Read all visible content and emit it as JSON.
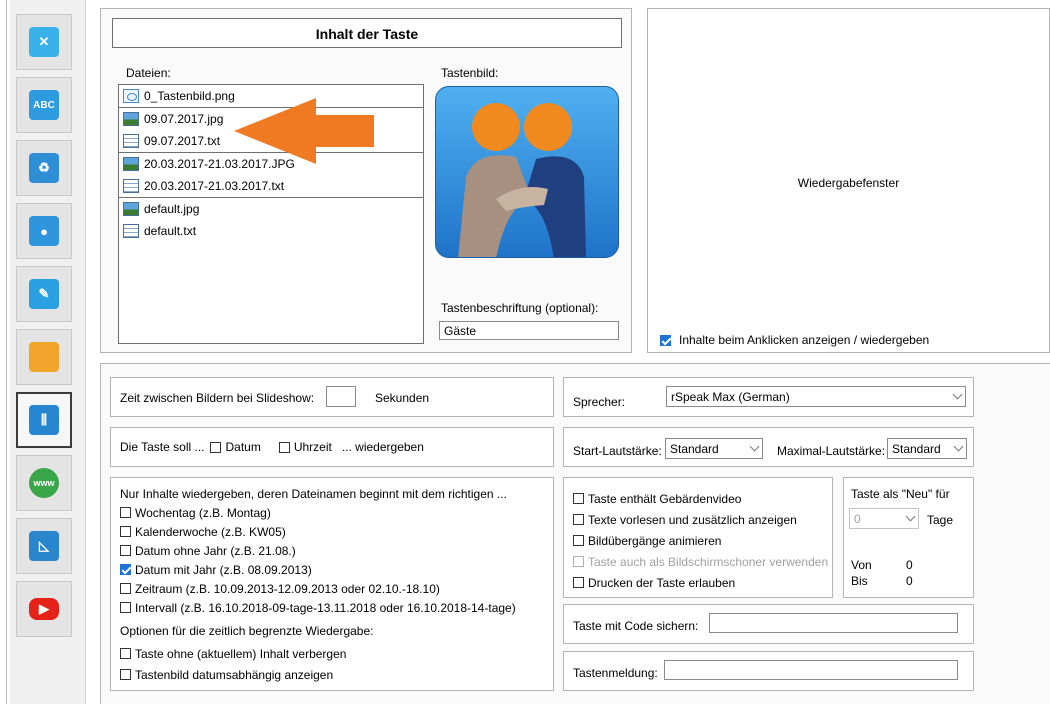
{
  "colors": {
    "accent": "#1e74d2",
    "arrow": "#f07a22"
  },
  "sidebar": {
    "tools": [
      {
        "icon": "tools-icon",
        "label": "Werkzeuge"
      },
      {
        "icon": "abc-eraser-icon",
        "label": "ABC"
      },
      {
        "icon": "recycle-bin-icon",
        "label": "Papierkorb"
      },
      {
        "icon": "microphone-icon",
        "label": "Mikrofon"
      },
      {
        "icon": "edit-note-icon",
        "label": "Bearbeiten"
      },
      {
        "icon": "folder-icon",
        "label": "Ordner"
      },
      {
        "icon": "sliders-icon",
        "label": "Einstellungen"
      },
      {
        "icon": "www-globe-icon",
        "label": "www"
      },
      {
        "icon": "ruler-triangle-icon",
        "label": "Lineal"
      },
      {
        "icon": "youtube-icon",
        "label": "YouTube"
      }
    ],
    "abc_text": "ABC",
    "www_text": "www"
  },
  "content": {
    "title": "Inhalt der Taste",
    "files_label": "Dateien:",
    "key_image_label": "Tastenbild:",
    "file_groups": [
      [
        {
          "type": "png",
          "name": "0_Tastenbild.png"
        }
      ],
      [
        {
          "type": "img",
          "name": "09.07.2017.jpg"
        },
        {
          "type": "txt",
          "name": "09.07.2017.txt"
        }
      ],
      [
        {
          "type": "img",
          "name": "20.03.2017-21.03.2017.JPG"
        },
        {
          "type": "txt",
          "name": "20.03.2017-21.03.2017.txt"
        }
      ],
      [
        {
          "type": "img",
          "name": "default.jpg"
        },
        {
          "type": "txt",
          "name": "default.txt"
        }
      ]
    ],
    "caption_label": "Tastenbeschriftung (optional):",
    "caption_value": "Gäste"
  },
  "playback": {
    "window_label": "Wiedergabefenster",
    "show_on_click_label": "Inhalte beim Anklicken anzeigen / wiedergeben",
    "show_on_click": true
  },
  "slideshow": {
    "label": "Zeit zwischen Bildern bei Slideshow:",
    "value": "",
    "unit": "Sekunden"
  },
  "playback_options": {
    "prefix": "Die Taste soll ...",
    "date_label": "Datum",
    "time_label": "Uhrzeit",
    "suffix": "... wiedergeben"
  },
  "filename_filter": {
    "heading": "Nur Inhalte wiedergeben, deren Dateinamen beginnt mit dem richtigen ...",
    "options": [
      {
        "label": "Wochentag (z.B. Montag)",
        "checked": false
      },
      {
        "label": "Kalenderwoche (z.B. KW05)",
        "checked": false
      },
      {
        "label": "Datum ohne Jahr (z.B. 21.08.)",
        "checked": false
      },
      {
        "label": "Datum mit Jahr (z.B. 08.09.2013)",
        "checked": true
      },
      {
        "label": "Zeitraum (z.B. 10.09.2013-12.09.2013 oder 02.10.-18.10)",
        "checked": false
      },
      {
        "label": "Intervall (z.B. 16.10.2018-09-tage-13.11.2018 oder 16.10.2018-14-tage)",
        "checked": false
      }
    ],
    "time_options_heading": "Optionen für die zeitlich begrenzte Wiedergabe:",
    "time_options": [
      {
        "label": "Taste ohne (aktuellem) Inhalt verbergen",
        "checked": false
      },
      {
        "label": "Tastenbild datumsabhängig anzeigen",
        "checked": false
      }
    ]
  },
  "voice": {
    "speaker_label": "Sprecher:",
    "speaker_value": "rSpeak Max (German)",
    "start_volume_label": "Start-Lautstärke:",
    "start_volume_value": "Standard",
    "max_volume_label": "Maximal-Lautstärke:",
    "max_volume_value": "Standard"
  },
  "key_options": [
    {
      "label": "Taste enthält Gebärdenvideo",
      "checked": false,
      "disabled": false
    },
    {
      "label": "Texte vorlesen und zusätzlich anzeigen",
      "checked": false,
      "disabled": false
    },
    {
      "label": "Bildübergänge animieren",
      "checked": false,
      "disabled": false
    },
    {
      "label": "Taste auch als Bildschirmschoner verwenden",
      "checked": false,
      "disabled": true
    },
    {
      "label": "Drucken der Taste erlauben",
      "checked": false,
      "disabled": false
    }
  ],
  "new_flag": {
    "heading": "Taste als \"Neu\" für",
    "days_value": "0",
    "days_label": "Tage",
    "from_label": "Von",
    "from_value": "0",
    "to_label": "Bis",
    "to_value": "0"
  },
  "code": {
    "label": "Taste mit Code sichern:",
    "value": ""
  },
  "message": {
    "label": "Tastenmeldung:",
    "value": ""
  }
}
